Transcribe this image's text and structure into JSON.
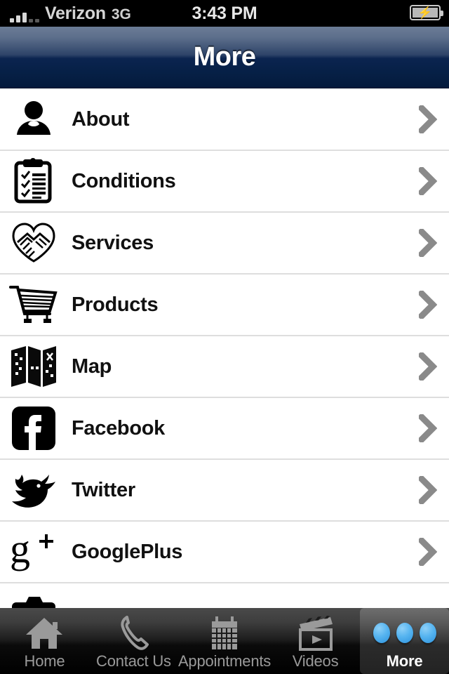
{
  "status_bar": {
    "carrier": "Verizon",
    "network": "3G",
    "time": "3:43 PM",
    "battery_icon": "battery-charging-icon",
    "signal_icon": "signal-bars-icon"
  },
  "nav_bar": {
    "title": "More",
    "gradient_top": "#6b7c96",
    "gradient_bottom": "#041a3c"
  },
  "list": {
    "rows": [
      {
        "label": "About",
        "icon": "person-icon",
        "chevron": "chevron-right-icon"
      },
      {
        "label": "Conditions",
        "icon": "clipboard-checklist-icon",
        "chevron": "chevron-right-icon"
      },
      {
        "label": "Services",
        "icon": "handshake-heart-icon",
        "chevron": "chevron-right-icon"
      },
      {
        "label": "Products",
        "icon": "shopping-cart-icon",
        "chevron": "chevron-right-icon"
      },
      {
        "label": "Map",
        "icon": "folded-map-icon",
        "chevron": "chevron-right-icon"
      },
      {
        "label": "Facebook",
        "icon": "facebook-icon",
        "chevron": "chevron-right-icon"
      },
      {
        "label": "Twitter",
        "icon": "twitter-bird-icon",
        "chevron": "chevron-right-icon"
      },
      {
        "label": "GooglePlus",
        "icon": "google-plus-icon",
        "chevron": "chevron-right-icon"
      },
      {
        "label": "",
        "icon": "camera-icon",
        "chevron": ""
      }
    ]
  },
  "tab_bar": {
    "tabs": [
      {
        "label": "Home",
        "icon": "home-icon",
        "active": false
      },
      {
        "label": "Contact Us",
        "icon": "phone-icon",
        "active": false
      },
      {
        "label": "Appointments",
        "icon": "calendar-icon",
        "active": false
      },
      {
        "label": "Videos",
        "icon": "clapperboard-icon",
        "active": false
      },
      {
        "label": "More",
        "icon": "three-dots-icon",
        "active": true
      }
    ],
    "active_color": "#ffffff",
    "inactive_color": "#9a9a9a",
    "dot_color": "#56b4f0"
  }
}
